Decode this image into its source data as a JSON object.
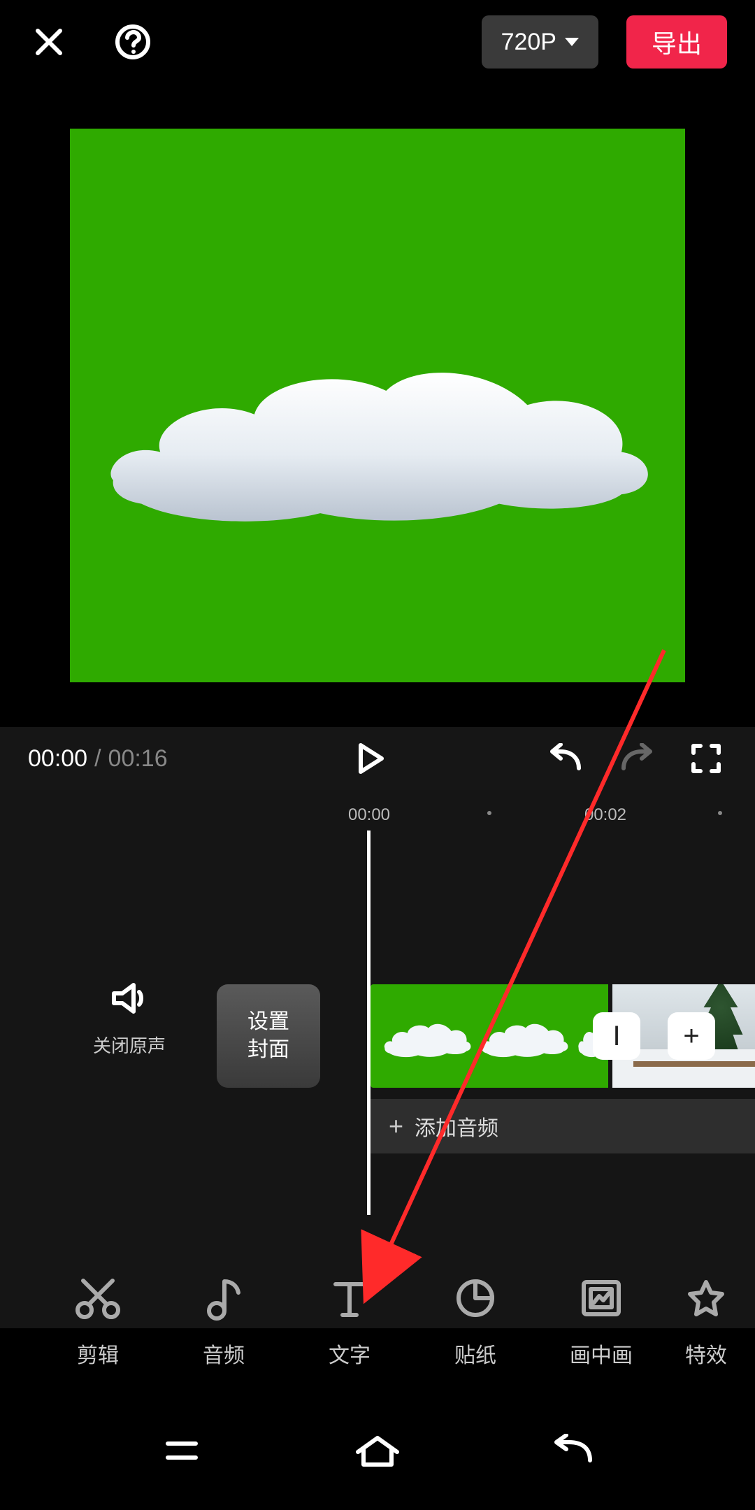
{
  "top": {
    "resolution_label": "720P",
    "export_label": "导出"
  },
  "playback": {
    "current": "00:00",
    "separator": "/",
    "duration": "00:16"
  },
  "ruler": {
    "t0": "00:00",
    "t1": "00:02"
  },
  "timeline_controls": {
    "mute_label": "关闭原声",
    "cover_button_l1": "设置",
    "cover_button_l2": "封面",
    "audio_add_label": "添加音频",
    "transition_minus": "I",
    "transition_plus": "+"
  },
  "tools": [
    {
      "key": "cut",
      "label": "剪辑"
    },
    {
      "key": "audio",
      "label": "音频"
    },
    {
      "key": "text",
      "label": "文字"
    },
    {
      "key": "sticker",
      "label": "贴纸"
    },
    {
      "key": "pip",
      "label": "画中画"
    },
    {
      "key": "fx",
      "label": "特效"
    }
  ]
}
